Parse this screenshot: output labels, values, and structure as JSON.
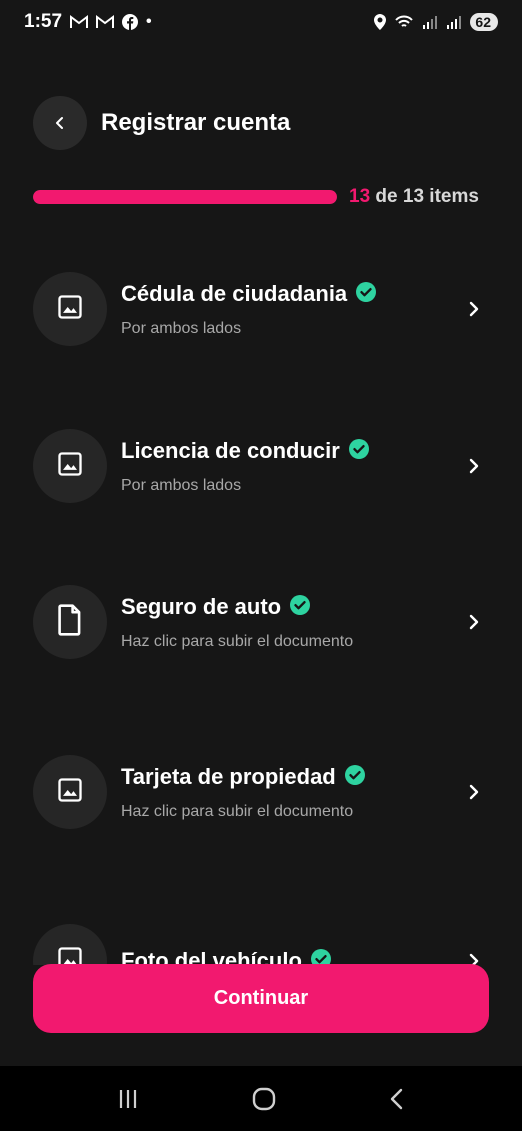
{
  "status_bar": {
    "time": "1:57",
    "dot": "•",
    "battery": "62",
    "icons": [
      "gmail-icon",
      "gmail-icon",
      "facebook-icon",
      "location-icon",
      "wifi-icon",
      "signal-icon",
      "signal-icon",
      "battery-icon"
    ]
  },
  "header": {
    "title": "Registrar cuenta",
    "back_icon": "chevron-left-icon"
  },
  "progress": {
    "current": "13",
    "suffix": "de 13 items",
    "fraction": 1.0
  },
  "documents": [
    {
      "title": "Cédula de ciudadania",
      "subtitle": "Por ambos lados",
      "icon": "image-icon",
      "verified": true
    },
    {
      "title": "Licencia de conducir",
      "subtitle": "Por ambos lados",
      "icon": "image-icon",
      "verified": true
    },
    {
      "title": "Seguro de auto",
      "subtitle": "Haz clic para subir el documento",
      "icon": "file-icon",
      "verified": true
    },
    {
      "title": "Tarjeta de propiedad",
      "subtitle": "Haz clic para subir el documento",
      "icon": "image-icon",
      "verified": true
    },
    {
      "title": "Foto del vehículo",
      "subtitle": "",
      "icon": "image-icon",
      "verified": true
    }
  ],
  "continue_label": "Continuar",
  "colors": {
    "accent": "#f2196f",
    "verified": "#2ed3a0",
    "background": "#161616"
  }
}
